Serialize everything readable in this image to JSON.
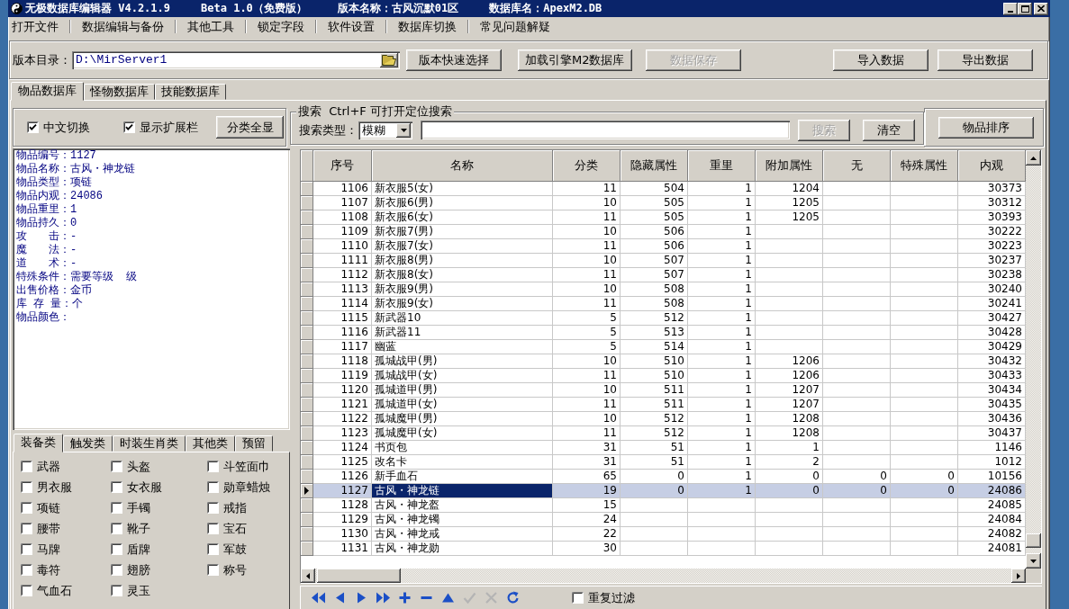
{
  "window": {
    "title_parts": [
      "无极数据库编辑器 V4.2.1.9",
      "Beta 1.0（免费版）",
      "版本名称：古风沉默01区",
      "数据库名：ApexM2.DB"
    ]
  },
  "menu": [
    "打开文件",
    "数据编辑与备份",
    "其他工具",
    "锁定字段",
    "软件设置",
    "数据库切换",
    "常见问题解疑"
  ],
  "toolbar": {
    "path_label": "版本目录：",
    "path_value": "D:\\MirServer1",
    "buttons": [
      {
        "label": "版本快速选择",
        "disabled": false
      },
      {
        "label": "加载引擎M2数据库",
        "disabled": false
      },
      {
        "label": "数据保存",
        "disabled": true
      }
    ],
    "io_buttons": [
      {
        "label": "导入数据",
        "disabled": false
      },
      {
        "label": "导出数据",
        "disabled": false
      }
    ]
  },
  "tabs": [
    {
      "label": "物品数据库",
      "selected": true
    },
    {
      "label": "怪物数据库",
      "selected": false
    },
    {
      "label": "技能数据库",
      "selected": false
    }
  ],
  "options": {
    "checkboxes": [
      {
        "label": "中文切换",
        "checked": true
      },
      {
        "label": "显示扩展栏",
        "checked": true
      }
    ],
    "button": {
      "label": "分类全显",
      "disabled": false
    }
  },
  "search": {
    "title": "搜索  Ctrl+F 可打开定位搜索",
    "type_label": "搜索类型：",
    "type_value": "模糊",
    "buttons": [
      {
        "label": "搜索",
        "disabled": true
      },
      {
        "label": "清空",
        "disabled": false
      }
    ]
  },
  "sort_button": {
    "label": "物品排序",
    "disabled": false
  },
  "item_info": [
    "物品编号：1127",
    "物品名称：古风・神龙链",
    "物品类型：项链",
    "物品内观：24086",
    "物品重里：1",
    "物品持久：0",
    "攻　　击：-",
    "魔　　法：-",
    "道　　术：-",
    "特殊条件：需要等级  级",
    "出售价格：金币",
    "库 存 量：个",
    "物品颜色："
  ],
  "category_tabs": [
    {
      "label": "装备类",
      "selected": true
    },
    {
      "label": "触发类",
      "selected": false
    },
    {
      "label": "时装生肖类",
      "selected": false
    },
    {
      "label": "其他类",
      "selected": false
    },
    {
      "label": "预留",
      "selected": false
    }
  ],
  "categories": [
    {
      "label": "武器",
      "checked": false
    },
    {
      "label": "头盔",
      "checked": false
    },
    {
      "label": "斗笠面巾",
      "checked": false
    },
    {
      "label": "男衣服",
      "checked": false
    },
    {
      "label": "女衣服",
      "checked": false
    },
    {
      "label": "勋章蜡烛",
      "checked": false
    },
    {
      "label": "项链",
      "checked": false
    },
    {
      "label": "手镯",
      "checked": false
    },
    {
      "label": "戒指",
      "checked": false
    },
    {
      "label": "腰带",
      "checked": false
    },
    {
      "label": "靴子",
      "checked": false
    },
    {
      "label": "宝石",
      "checked": false
    },
    {
      "label": "马牌",
      "checked": false
    },
    {
      "label": "盾牌",
      "checked": false
    },
    {
      "label": "军鼓",
      "checked": false
    },
    {
      "label": "毒符",
      "checked": false
    },
    {
      "label": "翅膀",
      "checked": false
    },
    {
      "label": "称号",
      "checked": false
    },
    {
      "label": "气血石",
      "checked": false
    },
    {
      "label": "灵玉",
      "checked": false
    }
  ],
  "table": {
    "columns": [
      "序号",
      "名称",
      "分类",
      "隐藏属性",
      "重里",
      "附加属性",
      "无",
      "特殊属性",
      "内观"
    ],
    "rows": [
      {
        "cells": [
          "1106",
          "新衣服5(女)",
          "11",
          "504",
          "1",
          "1204",
          null,
          null,
          "30373"
        ],
        "selected": false
      },
      {
        "cells": [
          "1107",
          "新衣服6(男)",
          "10",
          "505",
          "1",
          "1205",
          null,
          null,
          "30312"
        ],
        "selected": false
      },
      {
        "cells": [
          "1108",
          "新衣服6(女)",
          "11",
          "505",
          "1",
          "1205",
          null,
          null,
          "30393"
        ],
        "selected": false
      },
      {
        "cells": [
          "1109",
          "新衣服7(男)",
          "10",
          "506",
          "1",
          null,
          null,
          null,
          "30222"
        ],
        "selected": false
      },
      {
        "cells": [
          "1110",
          "新衣服7(女)",
          "11",
          "506",
          "1",
          null,
          null,
          null,
          "30223"
        ],
        "selected": false
      },
      {
        "cells": [
          "1111",
          "新衣服8(男)",
          "10",
          "507",
          "1",
          null,
          null,
          null,
          "30237"
        ],
        "selected": false
      },
      {
        "cells": [
          "1112",
          "新衣服8(女)",
          "11",
          "507",
          "1",
          null,
          null,
          null,
          "30238"
        ],
        "selected": false
      },
      {
        "cells": [
          "1113",
          "新衣服9(男)",
          "10",
          "508",
          "1",
          null,
          null,
          null,
          "30240"
        ],
        "selected": false
      },
      {
        "cells": [
          "1114",
          "新衣服9(女)",
          "11",
          "508",
          "1",
          null,
          null,
          null,
          "30241"
        ],
        "selected": false
      },
      {
        "cells": [
          "1115",
          "新武器10",
          "5",
          "512",
          "1",
          null,
          null,
          null,
          "30427"
        ],
        "selected": false
      },
      {
        "cells": [
          "1116",
          "新武器11",
          "5",
          "513",
          "1",
          null,
          null,
          null,
          "30428"
        ],
        "selected": false
      },
      {
        "cells": [
          "1117",
          "幽蓝",
          "5",
          "514",
          "1",
          null,
          null,
          null,
          "30429"
        ],
        "selected": false
      },
      {
        "cells": [
          "1118",
          "孤城战甲(男)",
          "10",
          "510",
          "1",
          "1206",
          null,
          null,
          "30432"
        ],
        "selected": false
      },
      {
        "cells": [
          "1119",
          "孤城战甲(女)",
          "11",
          "510",
          "1",
          "1206",
          null,
          null,
          "30433"
        ],
        "selected": false
      },
      {
        "cells": [
          "1120",
          "孤城道甲(男)",
          "10",
          "511",
          "1",
          "1207",
          null,
          null,
          "30434"
        ],
        "selected": false
      },
      {
        "cells": [
          "1121",
          "孤城道甲(女)",
          "11",
          "511",
          "1",
          "1207",
          null,
          null,
          "30435"
        ],
        "selected": false
      },
      {
        "cells": [
          "1122",
          "孤城魔甲(男)",
          "10",
          "512",
          "1",
          "1208",
          null,
          null,
          "30436"
        ],
        "selected": false
      },
      {
        "cells": [
          "1123",
          "孤城魔甲(女)",
          "11",
          "512",
          "1",
          "1208",
          null,
          null,
          "30437"
        ],
        "selected": false
      },
      {
        "cells": [
          "1124",
          "书页包",
          "31",
          "51",
          "1",
          "1",
          null,
          null,
          "1146"
        ],
        "selected": false
      },
      {
        "cells": [
          "1125",
          "改名卡",
          "31",
          "51",
          "1",
          "2",
          null,
          null,
          "1012"
        ],
        "selected": false
      },
      {
        "cells": [
          "1126",
          "新手血石",
          "65",
          "0",
          "1",
          "0",
          "0",
          "0",
          "10156"
        ],
        "selected": false
      },
      {
        "cells": [
          "1127",
          "古风・神龙链",
          "19",
          "0",
          "1",
          "0",
          "0",
          "0",
          "24086"
        ],
        "selected": true
      },
      {
        "cells": [
          "1128",
          "古风・神龙盔",
          "15",
          null,
          null,
          null,
          null,
          null,
          "24085"
        ],
        "selected": false
      },
      {
        "cells": [
          "1129",
          "古风・神龙镯",
          "24",
          null,
          null,
          null,
          null,
          null,
          "24084"
        ],
        "selected": false
      },
      {
        "cells": [
          "1130",
          "古风・神龙戒",
          "22",
          null,
          null,
          null,
          null,
          null,
          "24082"
        ],
        "selected": false
      },
      {
        "cells": [
          "1131",
          "古风・神龙勋",
          "30",
          null,
          null,
          null,
          null,
          null,
          "24081"
        ],
        "selected": false
      }
    ]
  },
  "navigator": {
    "buttons": [
      {
        "kind": "first",
        "disabled": false
      },
      {
        "kind": "prior",
        "disabled": false
      },
      {
        "kind": "next",
        "disabled": false
      },
      {
        "kind": "last",
        "disabled": false
      },
      {
        "kind": "insert",
        "disabled": false
      },
      {
        "kind": "delete",
        "disabled": false
      },
      {
        "kind": "edit",
        "disabled": false
      },
      {
        "kind": "post",
        "disabled": true
      },
      {
        "kind": "cancel",
        "disabled": true
      },
      {
        "kind": "refresh",
        "disabled": false
      }
    ],
    "checkbox": {
      "label": "重复过滤",
      "checked": false
    }
  }
}
